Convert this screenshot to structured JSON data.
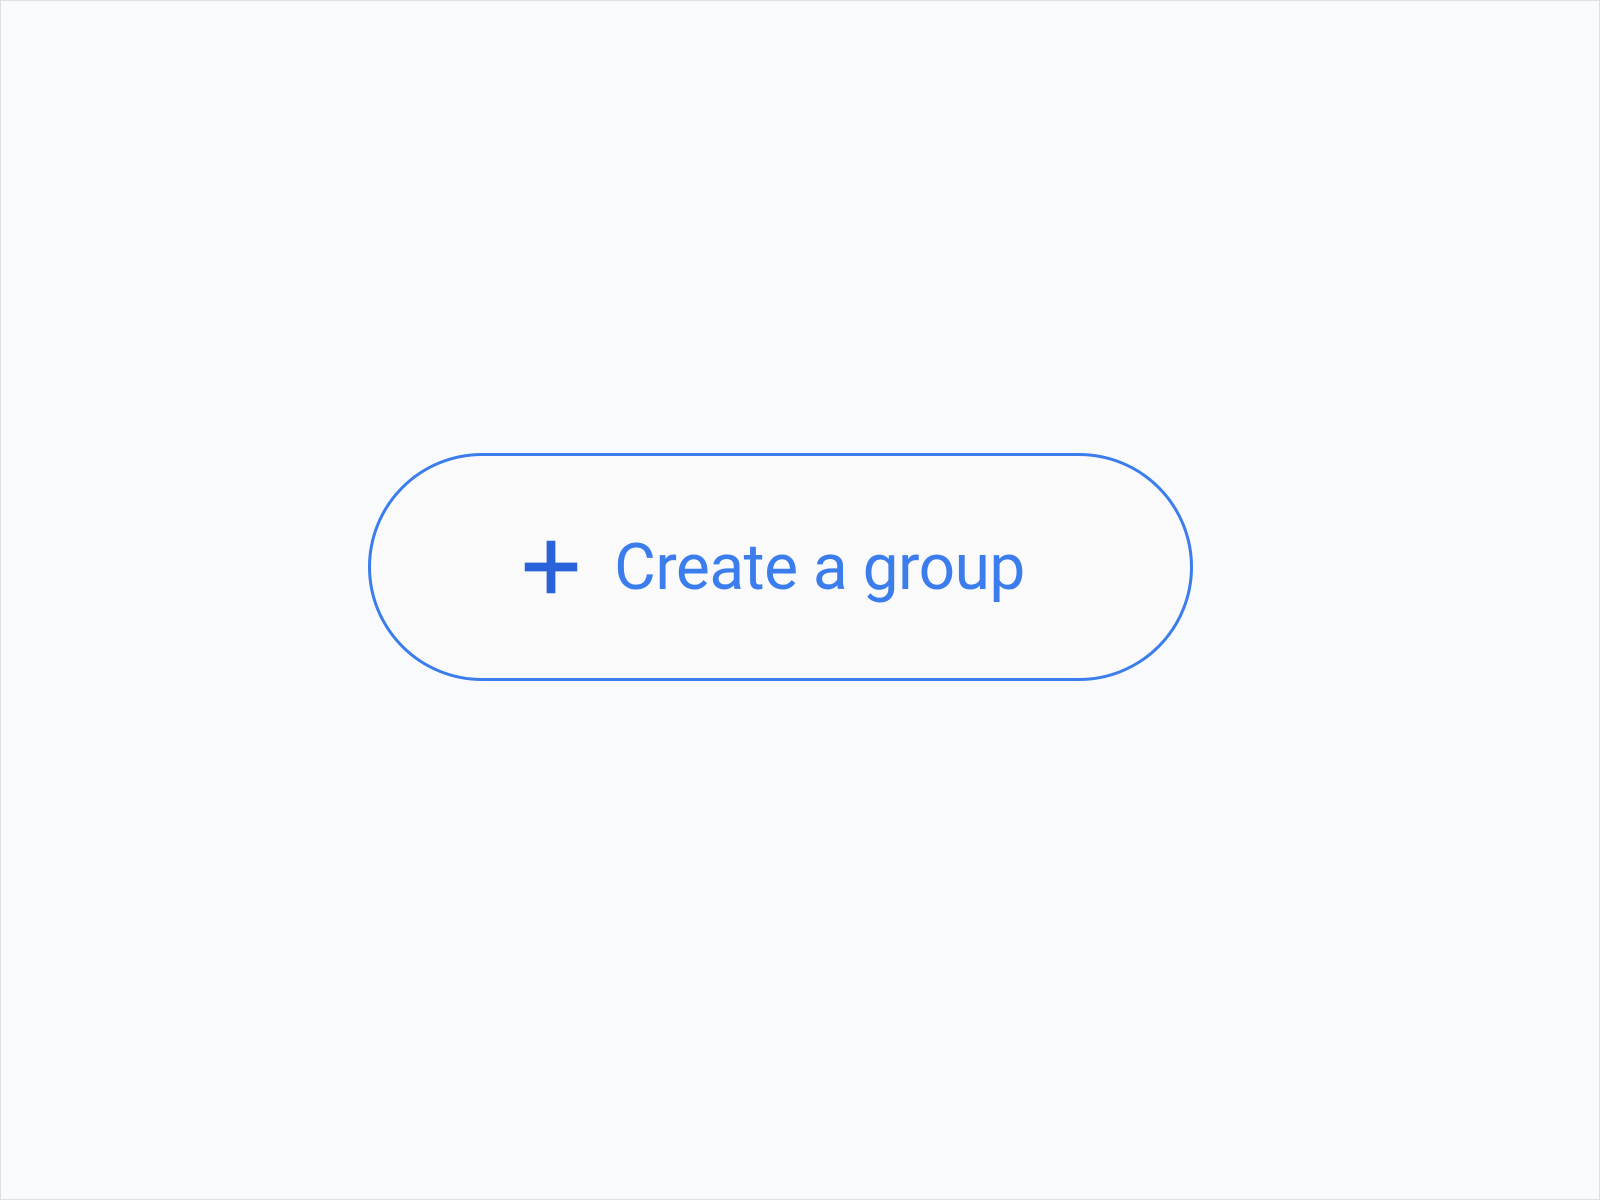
{
  "button": {
    "label": "Create a group",
    "icon": "plus-icon"
  },
  "colors": {
    "accent": "#3b7ded",
    "background": "#f9fafb"
  }
}
